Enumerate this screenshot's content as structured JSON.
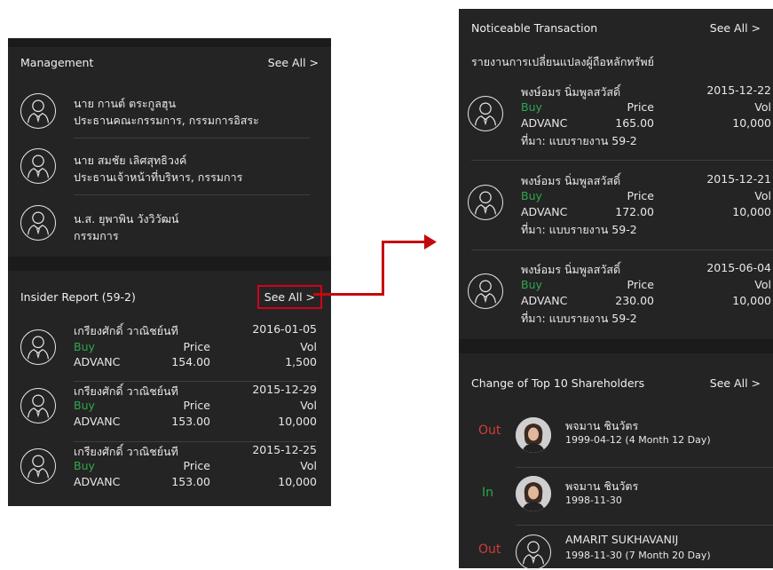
{
  "management": {
    "title": "Management",
    "see_all": "See All >",
    "people": [
      {
        "name": "นาย กานต์ ตระกูลฮุน",
        "role": "ประธานคณะกรรมการ, กรรมการอิสระ"
      },
      {
        "name": "นาย สมชัย เลิศสุทธิวงค์",
        "role": "ประธานเจ้าหน้าที่บริหาร, กรรมการ"
      },
      {
        "name": "น.ส. ยุพาพิน วังวิวัฒน์",
        "role": "กรรมการ"
      }
    ]
  },
  "insider": {
    "title": "Insider Report (59-2)",
    "see_all": "See All >",
    "rows": [
      {
        "name": "เกรียงศักดิ์ วาณิชย์นที",
        "date": "2016-01-05",
        "action": "Buy",
        "price_label": "Price",
        "vol_label": "Vol",
        "symbol": "ADVANC",
        "price": "154.00",
        "vol": "1,500"
      },
      {
        "name": "เกรียงศักดิ์ วาณิชย์นที",
        "date": "2015-12-29",
        "action": "Buy",
        "price_label": "Price",
        "vol_label": "Vol",
        "symbol": "ADVANC",
        "price": "153.00",
        "vol": "10,000"
      },
      {
        "name": "เกรียงศักดิ์ วาณิชย์นที",
        "date": "2015-12-25",
        "action": "Buy",
        "price_label": "Price",
        "vol_label": "Vol",
        "symbol": "ADVANC",
        "price": "153.00",
        "vol": "10,000"
      }
    ]
  },
  "noticeable": {
    "title": "Noticeable Transaction",
    "see_all": "See All >",
    "subtitle": "รายงานการเปลี่ยนแปลงผู้ถือหลักทรัพย์",
    "rows": [
      {
        "name": "พงษ์อมร นิ่มพูลสวัสดิ์",
        "date": "2015-12-22",
        "action": "Buy",
        "price_label": "Price",
        "vol_label": "Vol",
        "symbol": "ADVANC",
        "price": "165.00",
        "vol": "10,000",
        "source": "ที่มา: แบบรายงาน 59-2"
      },
      {
        "name": "พงษ์อมร นิ่มพูลสวัสดิ์",
        "date": "2015-12-21",
        "action": "Buy",
        "price_label": "Price",
        "vol_label": "Vol",
        "symbol": "ADVANC",
        "price": "172.00",
        "vol": "10,000",
        "source": "ที่มา: แบบรายงาน 59-2"
      },
      {
        "name": "พงษ์อมร นิ่มพูลสวัสดิ์",
        "date": "2015-06-04",
        "action": "Buy",
        "price_label": "Price",
        "vol_label": "Vol",
        "symbol": "ADVANC",
        "price": "230.00",
        "vol": "10,000",
        "source": "ที่มา: แบบรายงาน 59-2"
      }
    ]
  },
  "shareholders": {
    "title": "Change of Top 10 Shareholders",
    "see_all": "See All >",
    "rows": [
      {
        "status": "Out",
        "name": "พจมาน ชินวัตร",
        "detail": "1999-04-12 (4 Month 12 Day)"
      },
      {
        "status": "In",
        "name": "พจมาน ชินวัตร",
        "detail": "1998-11-30"
      },
      {
        "status": "Out",
        "name": "AMARIT SUKHAVANIJ",
        "detail": "1998-11-30 (7 Month 20 Day)"
      }
    ]
  },
  "colors": {
    "accent_red": "#c5080e",
    "buy_green": "#2ea84d",
    "status_red": "#d43a3a",
    "panel_bg": "#1b1b1b",
    "card_bg": "#242424"
  },
  "icons": {
    "person": "person-outline-icon",
    "photo": "person-photo-icon",
    "arrow": "arrow-right-icon"
  }
}
